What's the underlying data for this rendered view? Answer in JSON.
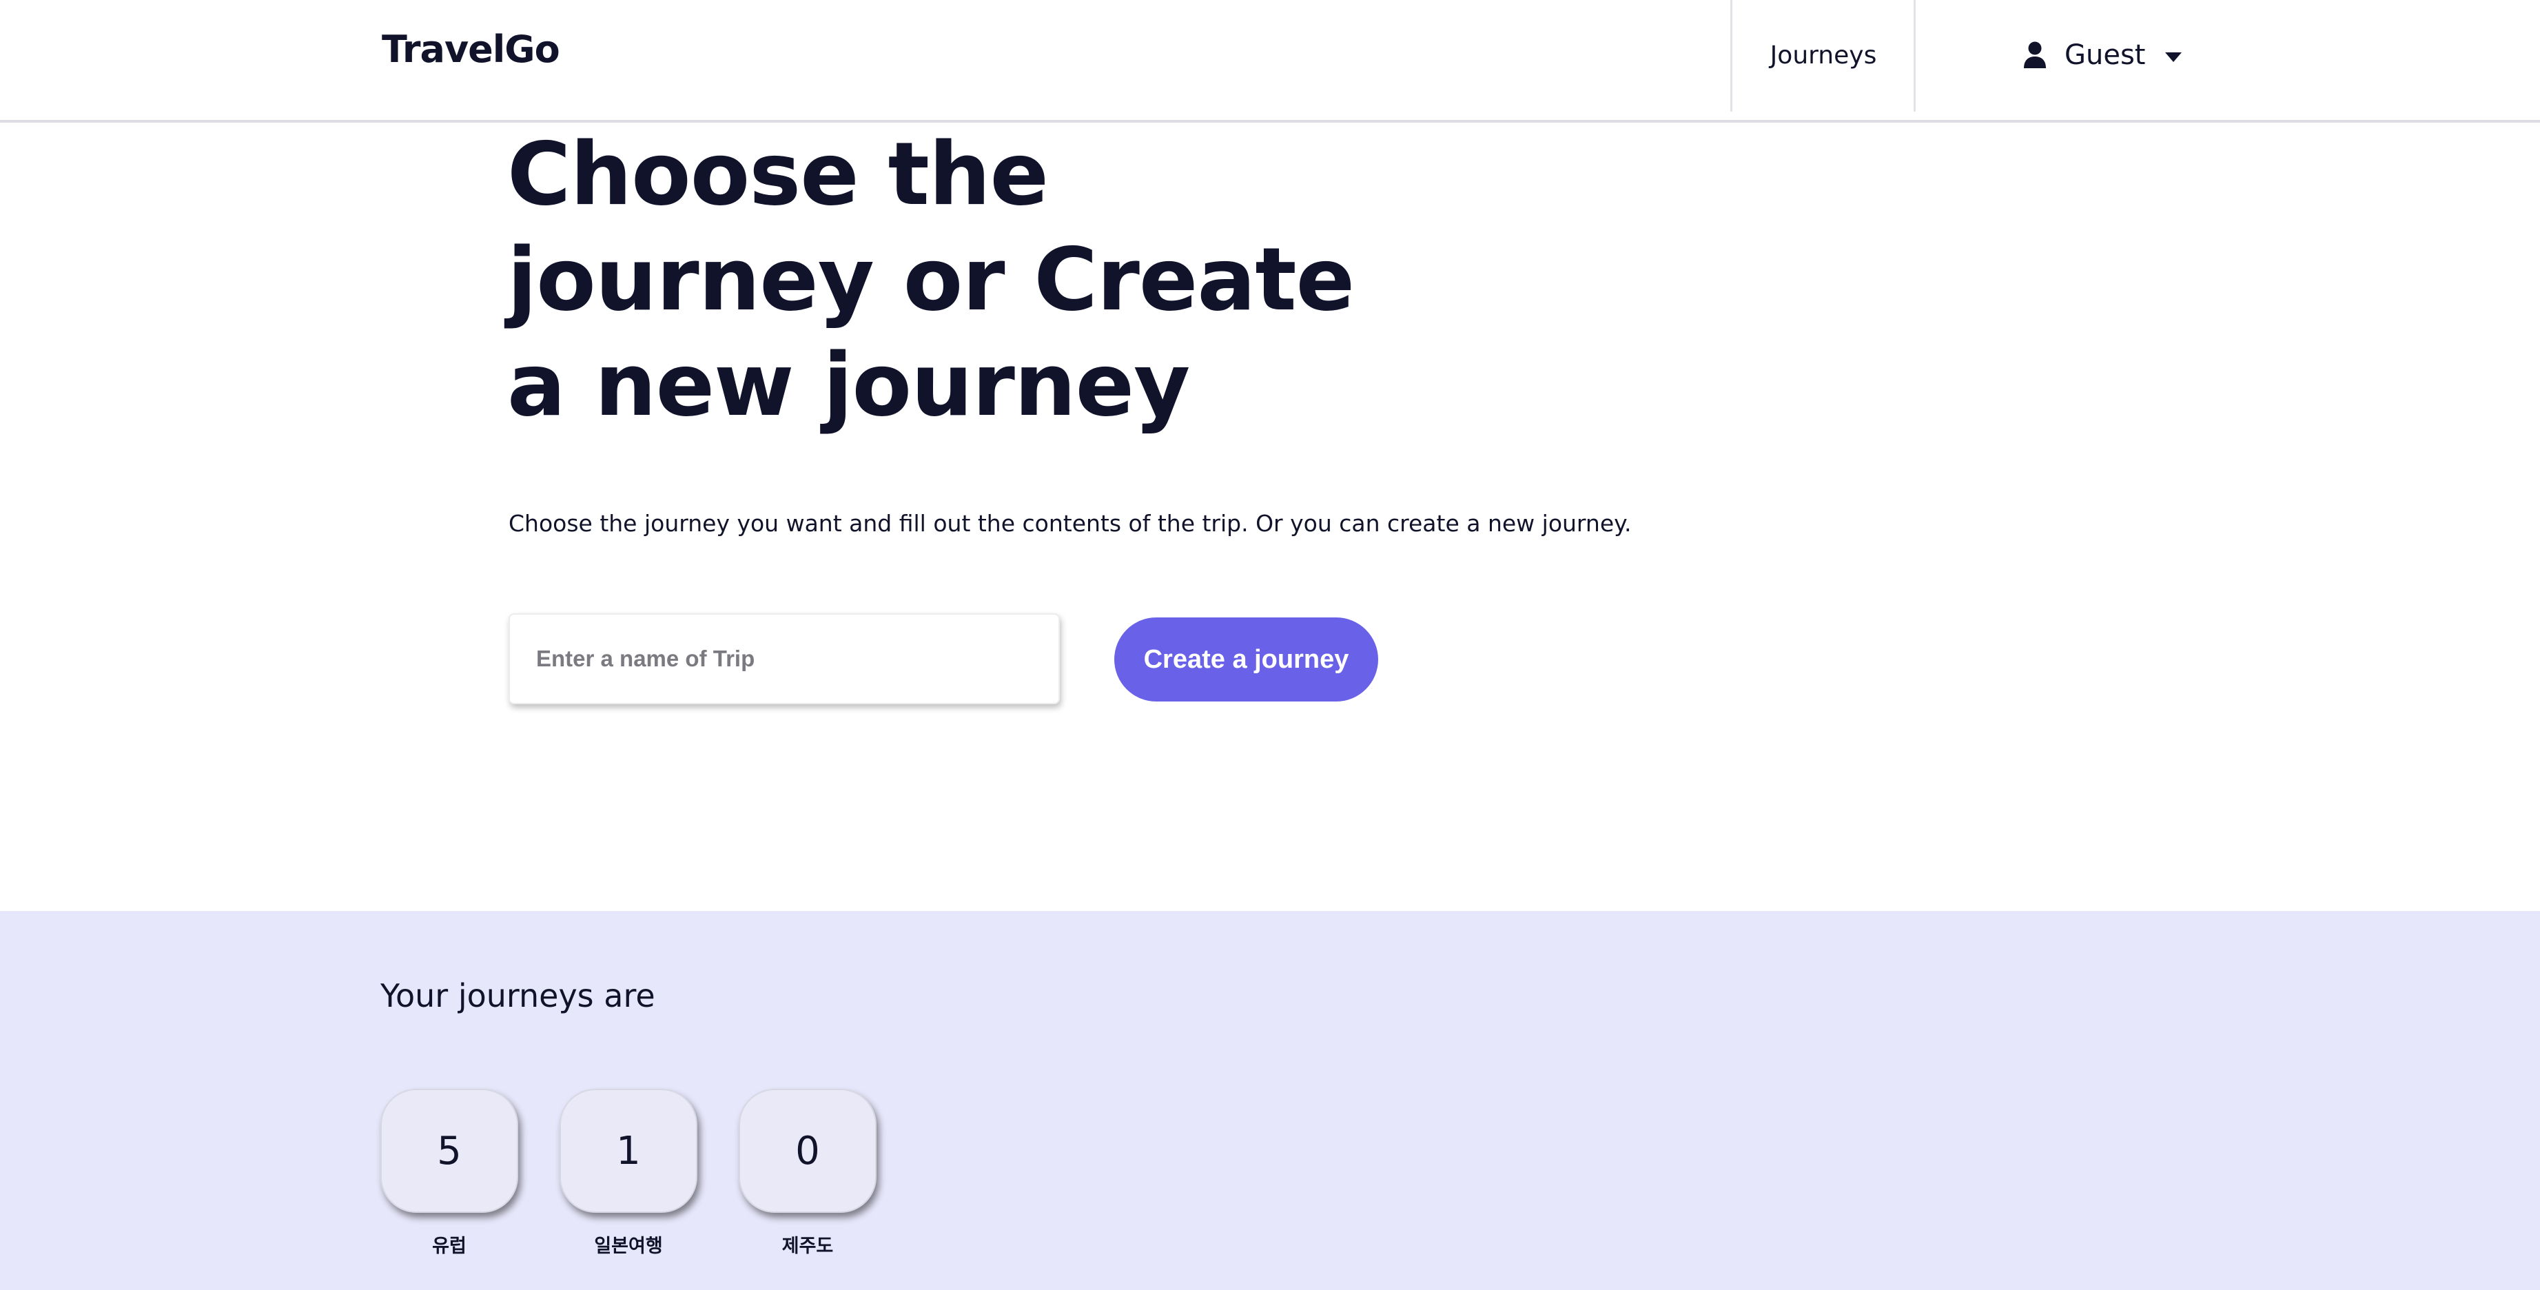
{
  "header": {
    "logo": "TravelGo",
    "nav_journeys": "Journeys",
    "user_name": "Guest",
    "user_icon": "user-icon",
    "caret_icon": "caret-down-icon"
  },
  "hero": {
    "title": "Choose the journey or Create a new journey",
    "subtitle": "Choose the journey you want and fill out the contents of the trip. Or you can create a new journey.",
    "input_placeholder": "Enter a name of Trip",
    "input_value": "",
    "create_button": "Create a journey"
  },
  "journeys": {
    "heading": "Your journeys are",
    "items": [
      {
        "count": "5",
        "name": "유럽"
      },
      {
        "count": "1",
        "name": "일본여행"
      },
      {
        "count": "0",
        "name": "제주도"
      }
    ]
  },
  "colors": {
    "accent": "#6961e8",
    "section_background": "#e7e7fb",
    "text": "#11132b"
  }
}
